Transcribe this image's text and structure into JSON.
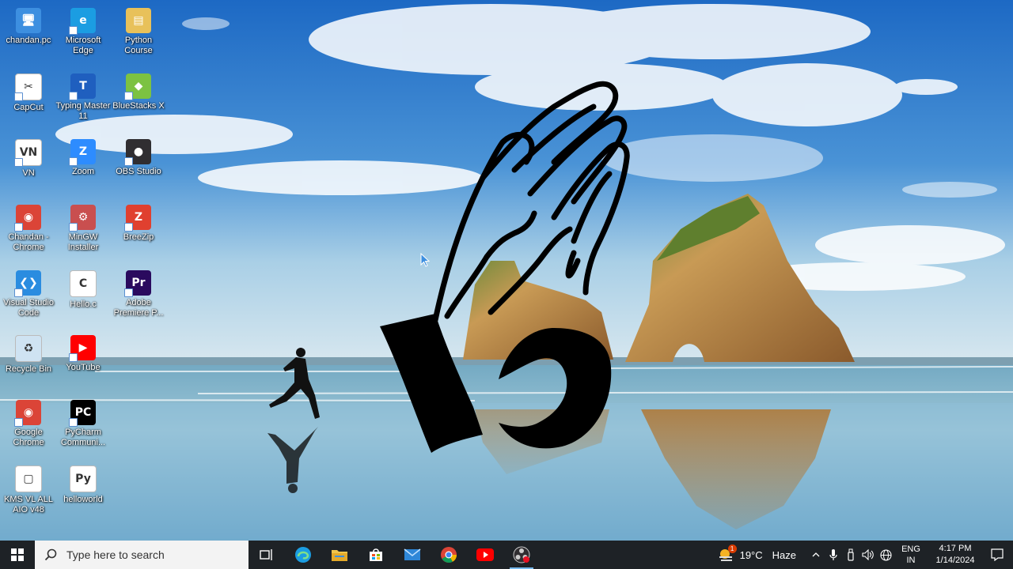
{
  "desktop": {
    "icons": [
      {
        "label": "chandan.pc",
        "icon": "this-pc-icon",
        "color": "#3d8fe0"
      },
      {
        "label": "Microsoft Edge",
        "icon": "edge-icon",
        "color": "#1b9de2"
      },
      {
        "label": "Python Course",
        "icon": "folder-icon",
        "color": "#e8c15a"
      },
      {
        "label": "CapCut",
        "icon": "capcut-icon",
        "color": "#ffffff"
      },
      {
        "label": "Typing Master 11",
        "icon": "typing-master-icon",
        "color": "#1f5fbf"
      },
      {
        "label": "BlueStacks X",
        "icon": "bluestacks-icon",
        "color": "#7cc242"
      },
      {
        "label": "VN",
        "icon": "vn-icon",
        "color": "#ffffff"
      },
      {
        "label": "Zoom",
        "icon": "zoom-icon",
        "color": "#2d8cff"
      },
      {
        "label": "OBS Studio",
        "icon": "obs-icon",
        "color": "#302e31"
      },
      {
        "label": "Chandan - Chrome",
        "icon": "chrome-profile-icon",
        "color": "#db4437"
      },
      {
        "label": "MinGW Installer",
        "icon": "mingw-icon",
        "color": "#c94f4f"
      },
      {
        "label": "BreeZip",
        "icon": "breezip-icon",
        "color": "#e0402f"
      },
      {
        "label": "Visual Studio Code",
        "icon": "vscode-icon",
        "color": "#2a8ce0"
      },
      {
        "label": "Hello.c",
        "icon": "c-file-icon",
        "color": "#ffffff"
      },
      {
        "label": "Adobe Premiere P...",
        "icon": "premiere-icon",
        "color": "#2a0a5e"
      },
      {
        "label": "Recycle Bin",
        "icon": "recycle-bin-icon",
        "color": "#cfe3f2"
      },
      {
        "label": "YouTube",
        "icon": "youtube-icon",
        "color": "#ff0000"
      },
      {
        "label": "Google Chrome",
        "icon": "chrome-icon",
        "color": "#db4437"
      },
      {
        "label": "PyCharm Communi...",
        "icon": "pycharm-icon",
        "color": "#000000"
      },
      {
        "label": "KMS VL ALL AIO v48",
        "icon": "script-file-icon",
        "color": "#ffffff"
      },
      {
        "label": "helloworld",
        "icon": "python-file-icon",
        "color": "#ffffff"
      }
    ]
  },
  "taskbar": {
    "search_placeholder": "Type here to search",
    "apps": [
      "task-view-icon",
      "edge-icon",
      "file-explorer-icon",
      "store-icon",
      "mail-icon",
      "chrome-icon",
      "youtube-icon",
      "obs-icon"
    ],
    "weather": {
      "temp": "19°C",
      "condition": "Haze",
      "alert_count": "1"
    },
    "language": {
      "line1": "ENG",
      "line2": "IN"
    },
    "clock": {
      "time": "4:17 PM",
      "date": "1/14/2024"
    }
  }
}
